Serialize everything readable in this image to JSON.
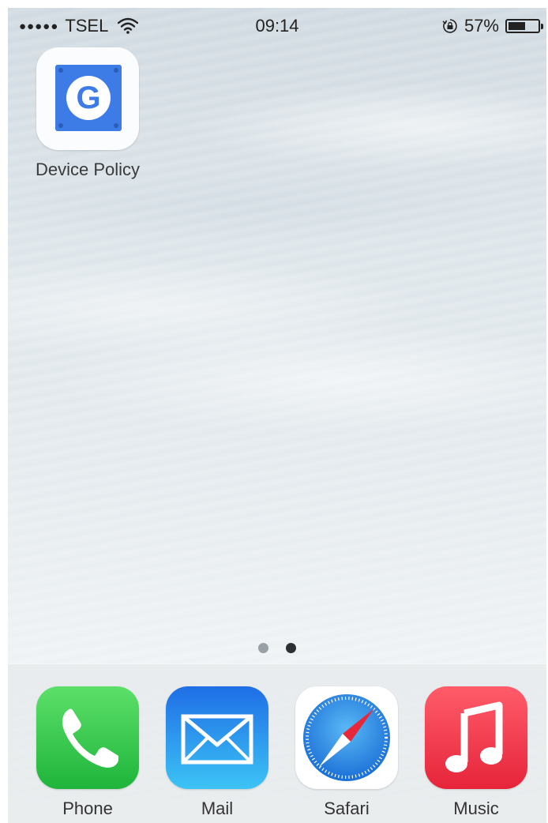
{
  "status_bar": {
    "signal_dots": "●●●●●",
    "carrier": "TSEL",
    "time": "09:14",
    "battery_percent": "57%",
    "battery_level": 0.57
  },
  "home_screen": {
    "apps": [
      {
        "label": "Device Policy",
        "icon": "google-device-policy-icon",
        "glyph": "G"
      }
    ]
  },
  "page_indicator": {
    "count": 2,
    "current": 2
  },
  "dock": {
    "apps": [
      {
        "label": "Phone",
        "icon": "phone-icon"
      },
      {
        "label": "Mail",
        "icon": "mail-icon"
      },
      {
        "label": "Safari",
        "icon": "safari-icon"
      },
      {
        "label": "Music",
        "icon": "music-icon"
      }
    ]
  },
  "colors": {
    "device_policy_blue": "#3d7be6",
    "phone_green": "#1fb43a",
    "mail_blue": "#1f6ee6",
    "music_red": "#e6243a"
  }
}
